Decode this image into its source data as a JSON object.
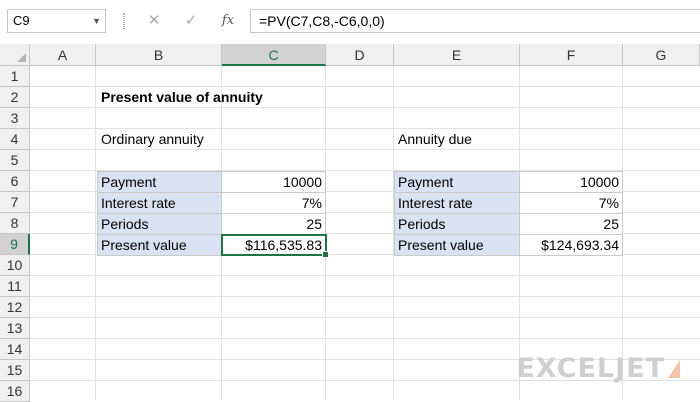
{
  "formula_bar": {
    "name_box": "C9",
    "cancel_icon": "x-icon",
    "enter_icon": "check-icon",
    "function_label": "fx",
    "formula": "=PV(C7,C8,-C6,0,0)"
  },
  "columns": [
    "A",
    "B",
    "C",
    "D",
    "E",
    "F",
    "G"
  ],
  "rows": [
    "1",
    "2",
    "3",
    "4",
    "5",
    "6",
    "7",
    "8",
    "9",
    "10",
    "11",
    "12",
    "13",
    "14",
    "15",
    "16"
  ],
  "sheet": {
    "title": "Present value of annuity",
    "ordinary": {
      "heading": "Ordinary annuity",
      "rows": [
        {
          "label": "Payment",
          "value": "10000"
        },
        {
          "label": "Interest rate",
          "value": "7%"
        },
        {
          "label": "Periods",
          "value": "25"
        },
        {
          "label": "Present value",
          "value": "$116,535.83"
        }
      ]
    },
    "due": {
      "heading": "Annuity due",
      "rows": [
        {
          "label": "Payment",
          "value": "10000"
        },
        {
          "label": "Interest rate",
          "value": "7%"
        },
        {
          "label": "Periods",
          "value": "25"
        },
        {
          "label": "Present value",
          "value": "$124,693.34"
        }
      ]
    }
  },
  "watermark": "EXCELJET",
  "colors": {
    "accent": "#217346",
    "label_fill": "#d9e1f2",
    "header_fill": "#f0f0f0"
  }
}
